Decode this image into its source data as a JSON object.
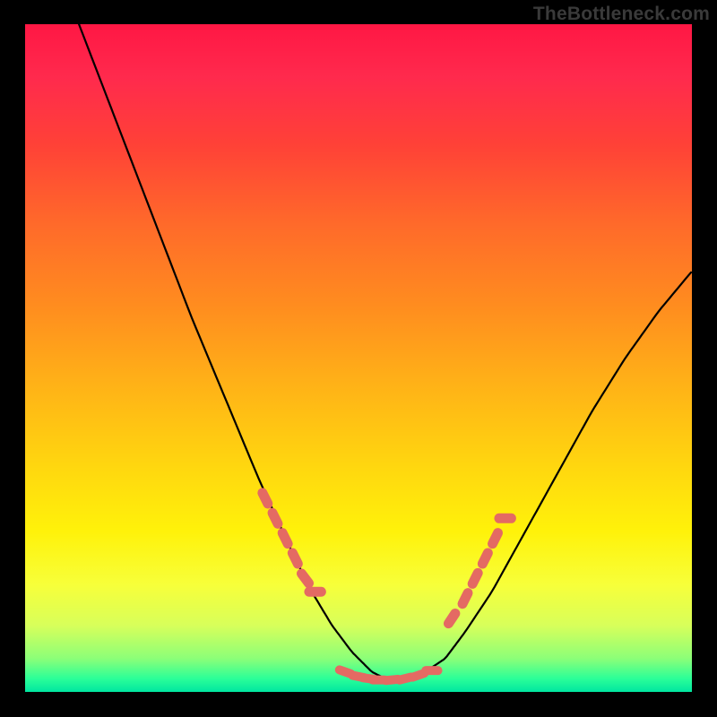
{
  "watermark": "TheBottleneck.com",
  "colors": {
    "frame": "#000000",
    "watermark_text": "#3a3a3a",
    "curve_stroke": "#000000",
    "dot_fill": "#e46a63",
    "gradient_stops": [
      "#ff1744",
      "#ff2a4d",
      "#ff4137",
      "#ff6a2a",
      "#ff8c1f",
      "#ffb217",
      "#ffd60f",
      "#fff20a",
      "#f7ff3a",
      "#d8ff5a",
      "#8cff78",
      "#2bff98",
      "#00e6a0"
    ]
  },
  "chart_data": {
    "type": "line",
    "title": "",
    "xlabel": "",
    "ylabel": "",
    "xlim": [
      0,
      100
    ],
    "ylim": [
      0,
      100
    ],
    "x": [
      0,
      5,
      10,
      15,
      20,
      25,
      30,
      35,
      40,
      43,
      46,
      49,
      52,
      54,
      57,
      60,
      63,
      66,
      70,
      75,
      80,
      85,
      90,
      95,
      100
    ],
    "values": [
      120,
      108,
      95,
      82,
      69,
      56,
      44,
      32,
      21,
      15,
      10,
      6,
      3,
      2,
      2,
      3,
      5,
      9,
      15,
      24,
      33,
      42,
      50,
      57,
      63
    ],
    "note": "values are bottleneck % (y); curve drops from off-chart high on the left to ~0 near x≈55 then rises again; y>100 means above visible top",
    "highlight_dots": {
      "comment": "pink dashed-dot overlay segments near the valley",
      "left_segment_x": [
        36,
        37.5,
        39,
        40.5,
        42,
        43.5
      ],
      "left_segment_y": [
        29,
        26,
        23,
        20,
        17,
        15
      ],
      "bottom_segment_x": [
        48,
        50,
        51.5,
        53,
        55,
        57,
        59,
        61
      ],
      "bottom_segment_y": [
        3,
        2.3,
        2,
        1.8,
        1.8,
        2,
        2.5,
        3.2
      ],
      "right_segment_x": [
        64,
        66,
        67.5,
        69,
        70.5,
        72
      ],
      "right_segment_y": [
        11,
        14,
        17,
        20,
        23,
        26
      ]
    }
  }
}
